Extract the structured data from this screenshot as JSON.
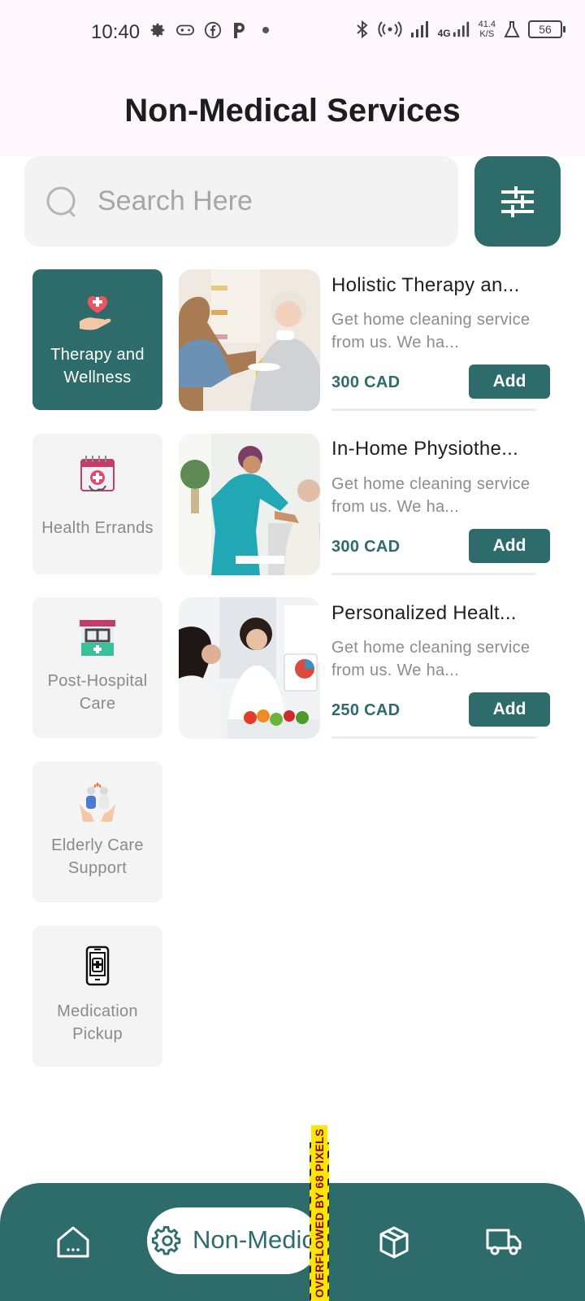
{
  "status_bar": {
    "time": "10:40",
    "network_speed_top": "41.4",
    "network_speed_bottom": "K/S",
    "network_type": "4G",
    "battery": "56",
    "icons_left": [
      "gear-icon",
      "gamepad-icon",
      "facebook-icon",
      "p-icon",
      "dot-icon"
    ],
    "icons_right": [
      "bluetooth-icon",
      "hotspot-icon",
      "signal-icon",
      "signal-4g-icon",
      "lab-icon",
      "battery-icon"
    ]
  },
  "header": {
    "title": "Non-Medical Services"
  },
  "search": {
    "placeholder": "Search Here",
    "value": ""
  },
  "categories": [
    {
      "label": "Therapy and Wellness",
      "icon": "heart-hand-icon",
      "active": true
    },
    {
      "label": "Health Errands",
      "icon": "calendar-medical-icon",
      "active": false
    },
    {
      "label": "Post-Hospital Care",
      "icon": "hospital-icon",
      "active": false
    },
    {
      "label": "Elderly Care Support",
      "icon": "elderly-care-icon",
      "active": false
    },
    {
      "label": "Medication Pickup",
      "icon": "phone-medicine-icon",
      "active": false
    }
  ],
  "services": [
    {
      "title": "Holistic Therapy an...",
      "desc": "Get home cleaning service from us. We ha...",
      "price": "300 CAD",
      "button": "Add"
    },
    {
      "title": "In-Home Physiothe...",
      "desc": "Get home cleaning service from us. We ha...",
      "price": "300 CAD",
      "button": "Add"
    },
    {
      "title": "Personalized Healt...",
      "desc": "Get home cleaning service from us. We ha...",
      "price": "250 CAD",
      "button": "Add"
    }
  ],
  "bottom_nav": {
    "items": [
      {
        "icon": "home-icon"
      },
      {
        "icon": "gear-icon",
        "label": "Non-Medic"
      },
      {
        "icon": "box-icon"
      },
      {
        "icon": "truck-icon"
      }
    ],
    "overflow_warning": "OVERFLOWED BY 68 PIXELS"
  },
  "colors": {
    "primary": "#2e6b6b",
    "card_bg": "#f4f4f5",
    "header_bg": "#fdf7fb"
  }
}
